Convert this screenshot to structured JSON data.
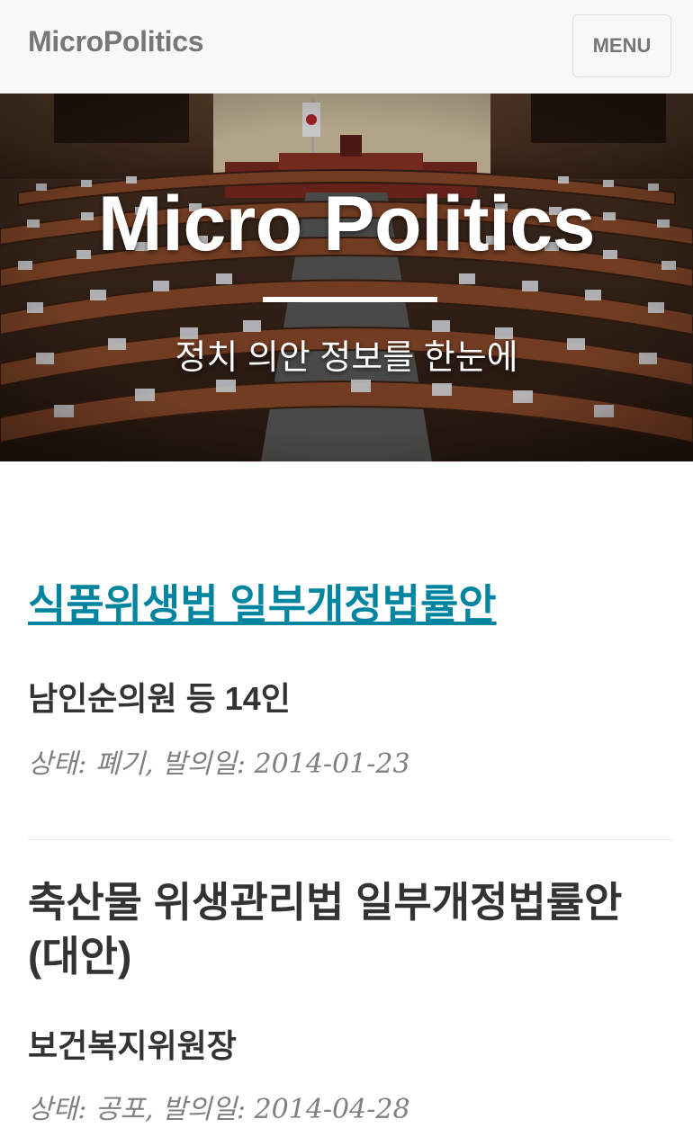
{
  "navbar": {
    "brand": "MicroPolitics",
    "menu_label": "MENU"
  },
  "hero": {
    "title": "Micro Politics",
    "subtitle": "정치 의안 정보를 한눈에"
  },
  "posts": [
    {
      "title": "식품위생법 일부개정법률안",
      "proposer": "남인순의원 등 14인",
      "meta": "상태: 폐기, 발의일: 2014-01-23"
    },
    {
      "title": "축산물 위생관리법 일부개정법률안(대안)",
      "proposer": "보건복지위원장",
      "meta": "상태: 공포, 발의일: 2014-04-28"
    }
  ],
  "colors": {
    "link": "#0085a1",
    "nav_bg": "#f8f8f8",
    "muted": "#808080"
  }
}
